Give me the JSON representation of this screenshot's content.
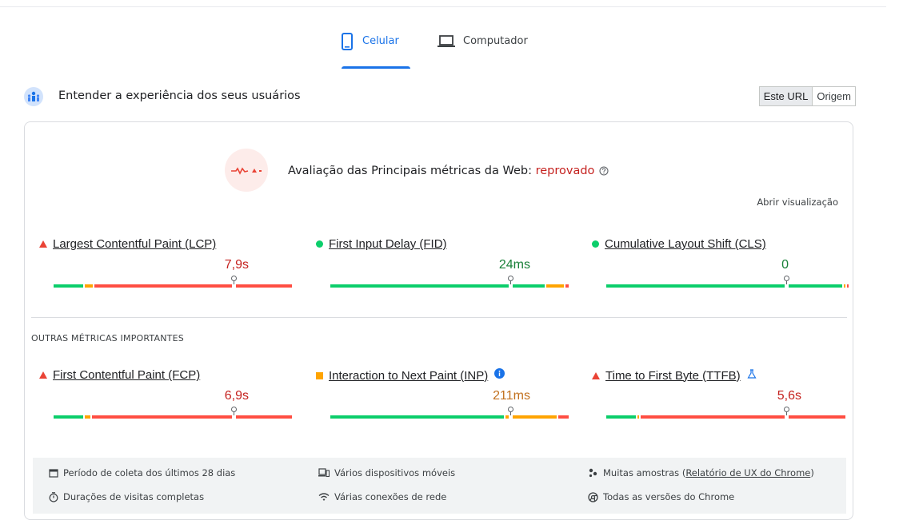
{
  "tabs": [
    {
      "label": "Celular",
      "icon": "smartphone-icon",
      "active": true
    },
    {
      "label": "Computador",
      "icon": "laptop-icon",
      "active": false
    }
  ],
  "section": {
    "title": "Entender a experiência dos seus usuários",
    "toggle": [
      "Este URL",
      "Origem"
    ]
  },
  "assessment": {
    "prefix": "Avaliação das Principais métricas da Web: ",
    "status": "reprovado",
    "expand_label": "Abrir visualização"
  },
  "core_metrics": [
    {
      "name": "Largest Contentful Paint (LCP)",
      "value": "7,9s",
      "rating": "poor",
      "percentile_marker": 0.75
    },
    {
      "name": "First Input Delay (FID)",
      "value": "24ms",
      "rating": "good",
      "percentile_marker": 0.75
    },
    {
      "name": "Cumulative Layout Shift (CLS)",
      "value": "0",
      "rating": "good",
      "percentile_marker": 0.75
    }
  ],
  "other_section_title": "OUTRAS MÉTRICAS IMPORTANTES",
  "other_metrics": [
    {
      "name": "First Contentful Paint (FCP)",
      "value": "6,9s",
      "rating": "poor",
      "percentile_marker": 0.75
    },
    {
      "name": "Interaction to Next Paint (INP)",
      "value": "211ms",
      "rating": "needs-improvement",
      "percentile_marker": 0.75,
      "badge_icon": "info-icon"
    },
    {
      "name": "Time to First Byte (TTFB)",
      "value": "5,6s",
      "rating": "poor",
      "percentile_marker": 0.75,
      "badge_icon": "flask-icon"
    }
  ],
  "distributions": [
    {
      "good": 0.13,
      "ni": 0.04,
      "poor": 0.83
    },
    {
      "good": 0.9,
      "ni": 0.08,
      "poor": 0.02
    },
    {
      "good": 0.99,
      "ni": 0.005,
      "poor": 0.005
    },
    {
      "good": 0.13,
      "ni": 0.03,
      "poor": 0.84
    },
    {
      "good": 0.73,
      "ni": 0.22,
      "poor": 0.05
    },
    {
      "good": 0.13,
      "ni": 0.01,
      "poor": 0.86
    }
  ],
  "footer": {
    "period": "Período de coleta dos últimos 28 dias",
    "durations": "Durações de visitas completas",
    "devices": "Vários dispositivos móveis",
    "connections": "Várias conexões de rede",
    "samples_prefix": "Muitas amostras (",
    "samples_link": "Relatório de UX do Chrome",
    "samples_suffix": ")",
    "versions": "Todas as versões do Chrome"
  },
  "colors": {
    "accent": "#1a73e8",
    "good": "#0cce6b",
    "needs_improvement": "#ffa400",
    "poor": "#ff4e42",
    "poor_text": "#c5221f",
    "good_text": "#188038",
    "ni_text": "#c2711f"
  }
}
